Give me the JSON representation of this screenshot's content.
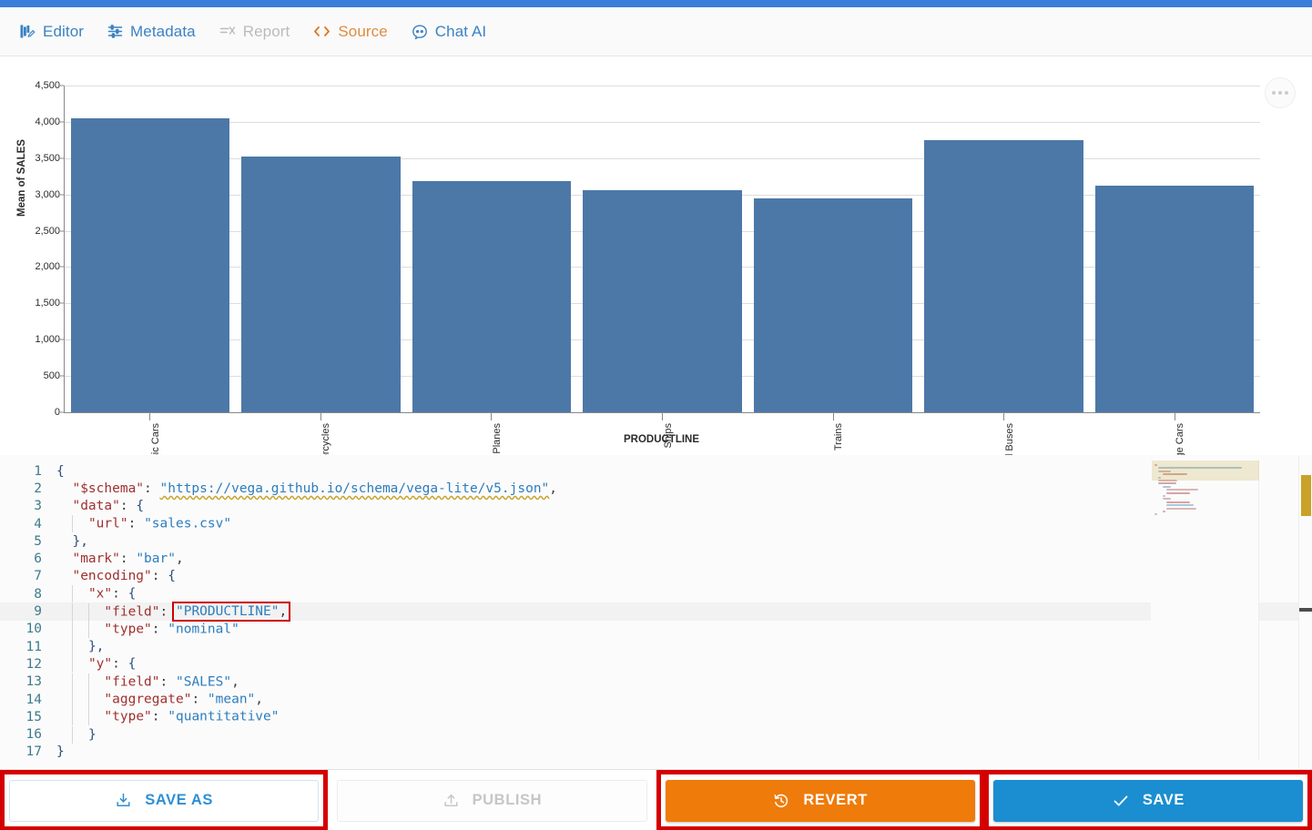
{
  "top_strip_color": "#3b7dd8",
  "tabs": [
    {
      "label": "Editor",
      "icon": "editor-icon",
      "state": "blue"
    },
    {
      "label": "Metadata",
      "icon": "metadata-icon",
      "state": "blue"
    },
    {
      "label": "Report",
      "icon": "report-icon",
      "state": "muted"
    },
    {
      "label": "Source",
      "icon": "source-code-icon",
      "state": "orange"
    },
    {
      "label": "Chat AI",
      "icon": "chat-ai-icon",
      "state": "blue"
    }
  ],
  "chart_menu": {
    "icon": "more-options-icon"
  },
  "chart_data": {
    "type": "bar",
    "title": "",
    "xlabel": "PRODUCTLINE",
    "ylabel": "Mean of SALES",
    "categories": [
      "Classic Cars",
      "Motorcycles",
      "Planes",
      "Ships",
      "Trains",
      "Trucks and Buses",
      "Vintage Cars"
    ],
    "values": [
      4053,
      3524,
      3179,
      3063,
      2947,
      3746,
      3121
    ],
    "ylim": [
      0,
      4500
    ],
    "yticks": [
      0,
      500,
      1000,
      1500,
      2000,
      2500,
      3000,
      3500,
      4000,
      4500
    ],
    "ytick_labels": [
      "0",
      "500",
      "1,000",
      "1,500",
      "2,000",
      "2,500",
      "3,000",
      "3,500",
      "4,000",
      "4,500"
    ],
    "grid": true,
    "legend": "none",
    "bar_color": "#4c78a8"
  },
  "editor": {
    "highlighted_line": 9,
    "highlighted_token": "\"PRODUCTLINE\",",
    "lines": [
      {
        "n": "1",
        "text": "{"
      },
      {
        "n": "2",
        "text": "  \"$schema\": \"https://vega.github.io/schema/vega-lite/v5.json\","
      },
      {
        "n": "3",
        "text": "  \"data\": {"
      },
      {
        "n": "4",
        "text": "    \"url\": \"sales.csv\""
      },
      {
        "n": "5",
        "text": "  },"
      },
      {
        "n": "6",
        "text": "  \"mark\": \"bar\","
      },
      {
        "n": "7",
        "text": "  \"encoding\": {"
      },
      {
        "n": "8",
        "text": "    \"x\": {"
      },
      {
        "n": "9",
        "text": "      \"field\": \"PRODUCTLINE\","
      },
      {
        "n": "10",
        "text": "      \"type\": \"nominal\""
      },
      {
        "n": "11",
        "text": "    },"
      },
      {
        "n": "12",
        "text": "    \"y\": {"
      },
      {
        "n": "13",
        "text": "      \"field\": \"SALES\","
      },
      {
        "n": "14",
        "text": "      \"aggregate\": \"mean\","
      },
      {
        "n": "15",
        "text": "      \"type\": \"quantitative\""
      },
      {
        "n": "16",
        "text": "    }"
      },
      {
        "n": "17",
        "text": "}"
      }
    ]
  },
  "actions": {
    "save_as": {
      "label": "SAVE AS",
      "icon": "download-icon",
      "highlighted": true,
      "enabled": true
    },
    "publish": {
      "label": "PUBLISH",
      "icon": "upload-icon",
      "highlighted": false,
      "enabled": false
    },
    "revert": {
      "label": "REVERT",
      "icon": "history-icon",
      "highlighted": true,
      "enabled": true,
      "color": "#ef7b0a"
    },
    "save": {
      "label": "SAVE",
      "icon": "check-icon",
      "highlighted": true,
      "enabled": true,
      "color": "#1a8ed1"
    }
  }
}
